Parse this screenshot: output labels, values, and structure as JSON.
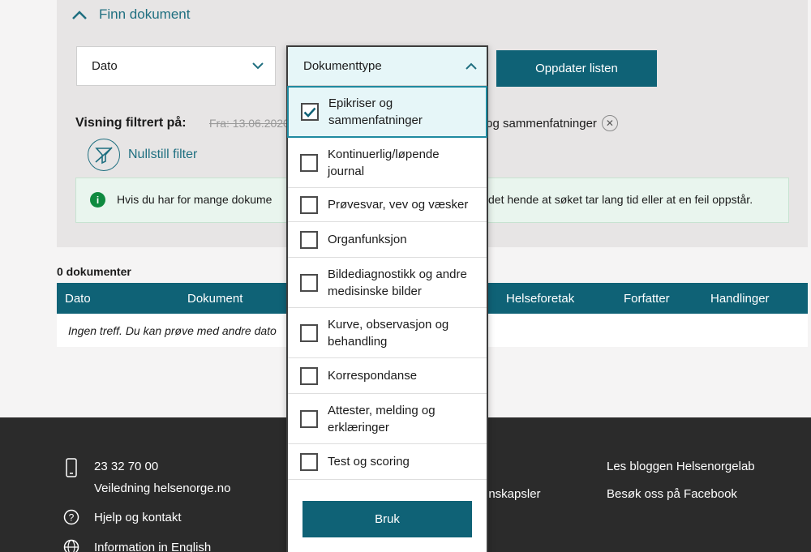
{
  "panel": {
    "toggle_label": "Finn dokument",
    "date_select": "Dato",
    "update_button": "Oppdater listen",
    "filtered_label": "Visning filtrert på:",
    "chip_date": "Fra: 13.06.2020",
    "chip_type_visible": "r og sammenfatninger",
    "reset_label": "Nullstill filter",
    "info_text_left": "Hvis du har for mange dokume",
    "info_text_right": "det hende at søket tar lang tid eller at en feil oppstår."
  },
  "results": {
    "count_label": "0 dokumenter",
    "columns": [
      "Dato",
      "Dokument",
      "Helseforetak",
      "Forfatter",
      "Handlinger"
    ],
    "empty_text": "Ingen treff. Du kan prøve med andre dato"
  },
  "dropdown": {
    "header": "Dokumenttype",
    "options": [
      {
        "label": "Epikriser og sammenfatninger",
        "checked": true
      },
      {
        "label": "Kontinuerlig/løpende journal",
        "checked": false
      },
      {
        "label": "Prøvesvar, vev og væsker",
        "checked": false
      },
      {
        "label": "Organfunksjon",
        "checked": false
      },
      {
        "label": "Bildediagnostikk og andre medisinske bilder",
        "checked": false
      },
      {
        "label": "Kurve, observasjon og behandling",
        "checked": false
      },
      {
        "label": "Korrespondanse",
        "checked": false
      },
      {
        "label": "Attester, melding og erklæringer",
        "checked": false
      },
      {
        "label": "Test og scoring",
        "checked": false
      }
    ],
    "apply_button": "Bruk"
  },
  "footer": {
    "phone": "23 32 70 00",
    "guidance": "Veiledning helsenorge.no",
    "help": "Hjelp og kontakt",
    "english": "Information in English",
    "middle_partial": "onskapsler",
    "blog": "Les bloggen Helsenorgelab",
    "facebook": "Besøk oss på Facebook"
  },
  "colors": {
    "primary": "#0f6276",
    "accent_text": "#1f6f80",
    "footer_bg": "#2b2b2b",
    "info_bg": "#e9f5ee"
  }
}
